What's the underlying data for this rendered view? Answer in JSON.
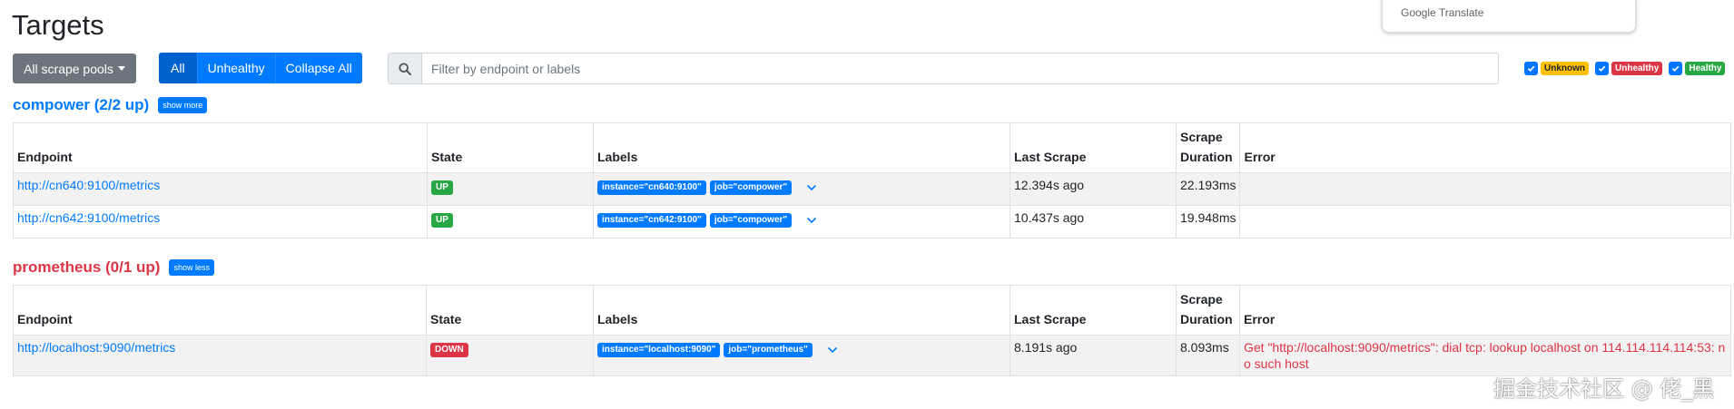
{
  "page": {
    "title": "Targets"
  },
  "google_translate": {
    "label": "Google Translate"
  },
  "toolbar": {
    "scrape_pools_label": "All scrape pools",
    "buttons": {
      "all": "All",
      "unhealthy": "Unhealthy",
      "collapse_all": "Collapse All"
    },
    "search_placeholder": "Filter by endpoint or labels"
  },
  "filters": {
    "unknown": "Unknown",
    "unhealthy": "Unhealthy",
    "healthy": "Healthy"
  },
  "columns": {
    "endpoint": "Endpoint",
    "state": "State",
    "labels": "Labels",
    "last_scrape": "Last Scrape",
    "scrape_duration": "Scrape Duration",
    "error": "Error"
  },
  "pools": [
    {
      "title": "compower (2/2 up)",
      "toggle": "show more",
      "rows": [
        {
          "endpoint": "http://cn640:9100/metrics",
          "state": "UP",
          "labels": [
            "instance=\"cn640:9100\"",
            "job=\"compower\""
          ],
          "last_scrape": "12.394s ago",
          "duration": "22.193ms",
          "error": ""
        },
        {
          "endpoint": "http://cn642:9100/metrics",
          "state": "UP",
          "labels": [
            "instance=\"cn642:9100\"",
            "job=\"compower\""
          ],
          "last_scrape": "10.437s ago",
          "duration": "19.948ms",
          "error": ""
        }
      ]
    },
    {
      "title": "prometheus (0/1 up)",
      "toggle": "show less",
      "rows": [
        {
          "endpoint": "http://localhost:9090/metrics",
          "state": "DOWN",
          "labels": [
            "instance=\"localhost:9090\"",
            "job=\"prometheus\""
          ],
          "last_scrape": "8.191s ago",
          "duration": "8.093ms",
          "error": "Get \"http://localhost:9090/metrics\": dial tcp: lookup localhost on 114.114.114.114:53: no such host"
        }
      ]
    }
  ],
  "watermark": "掘金技术社区 @ 佬_黑",
  "colors": {
    "primary": "#007bff",
    "success": "#28a745",
    "danger": "#dc3545",
    "warning": "#ffc107",
    "secondary": "#6c757d"
  },
  "icons": {
    "search": "search-icon",
    "caret": "caret-down-icon",
    "check": "check-icon",
    "expand": "chevron-down-icon"
  }
}
